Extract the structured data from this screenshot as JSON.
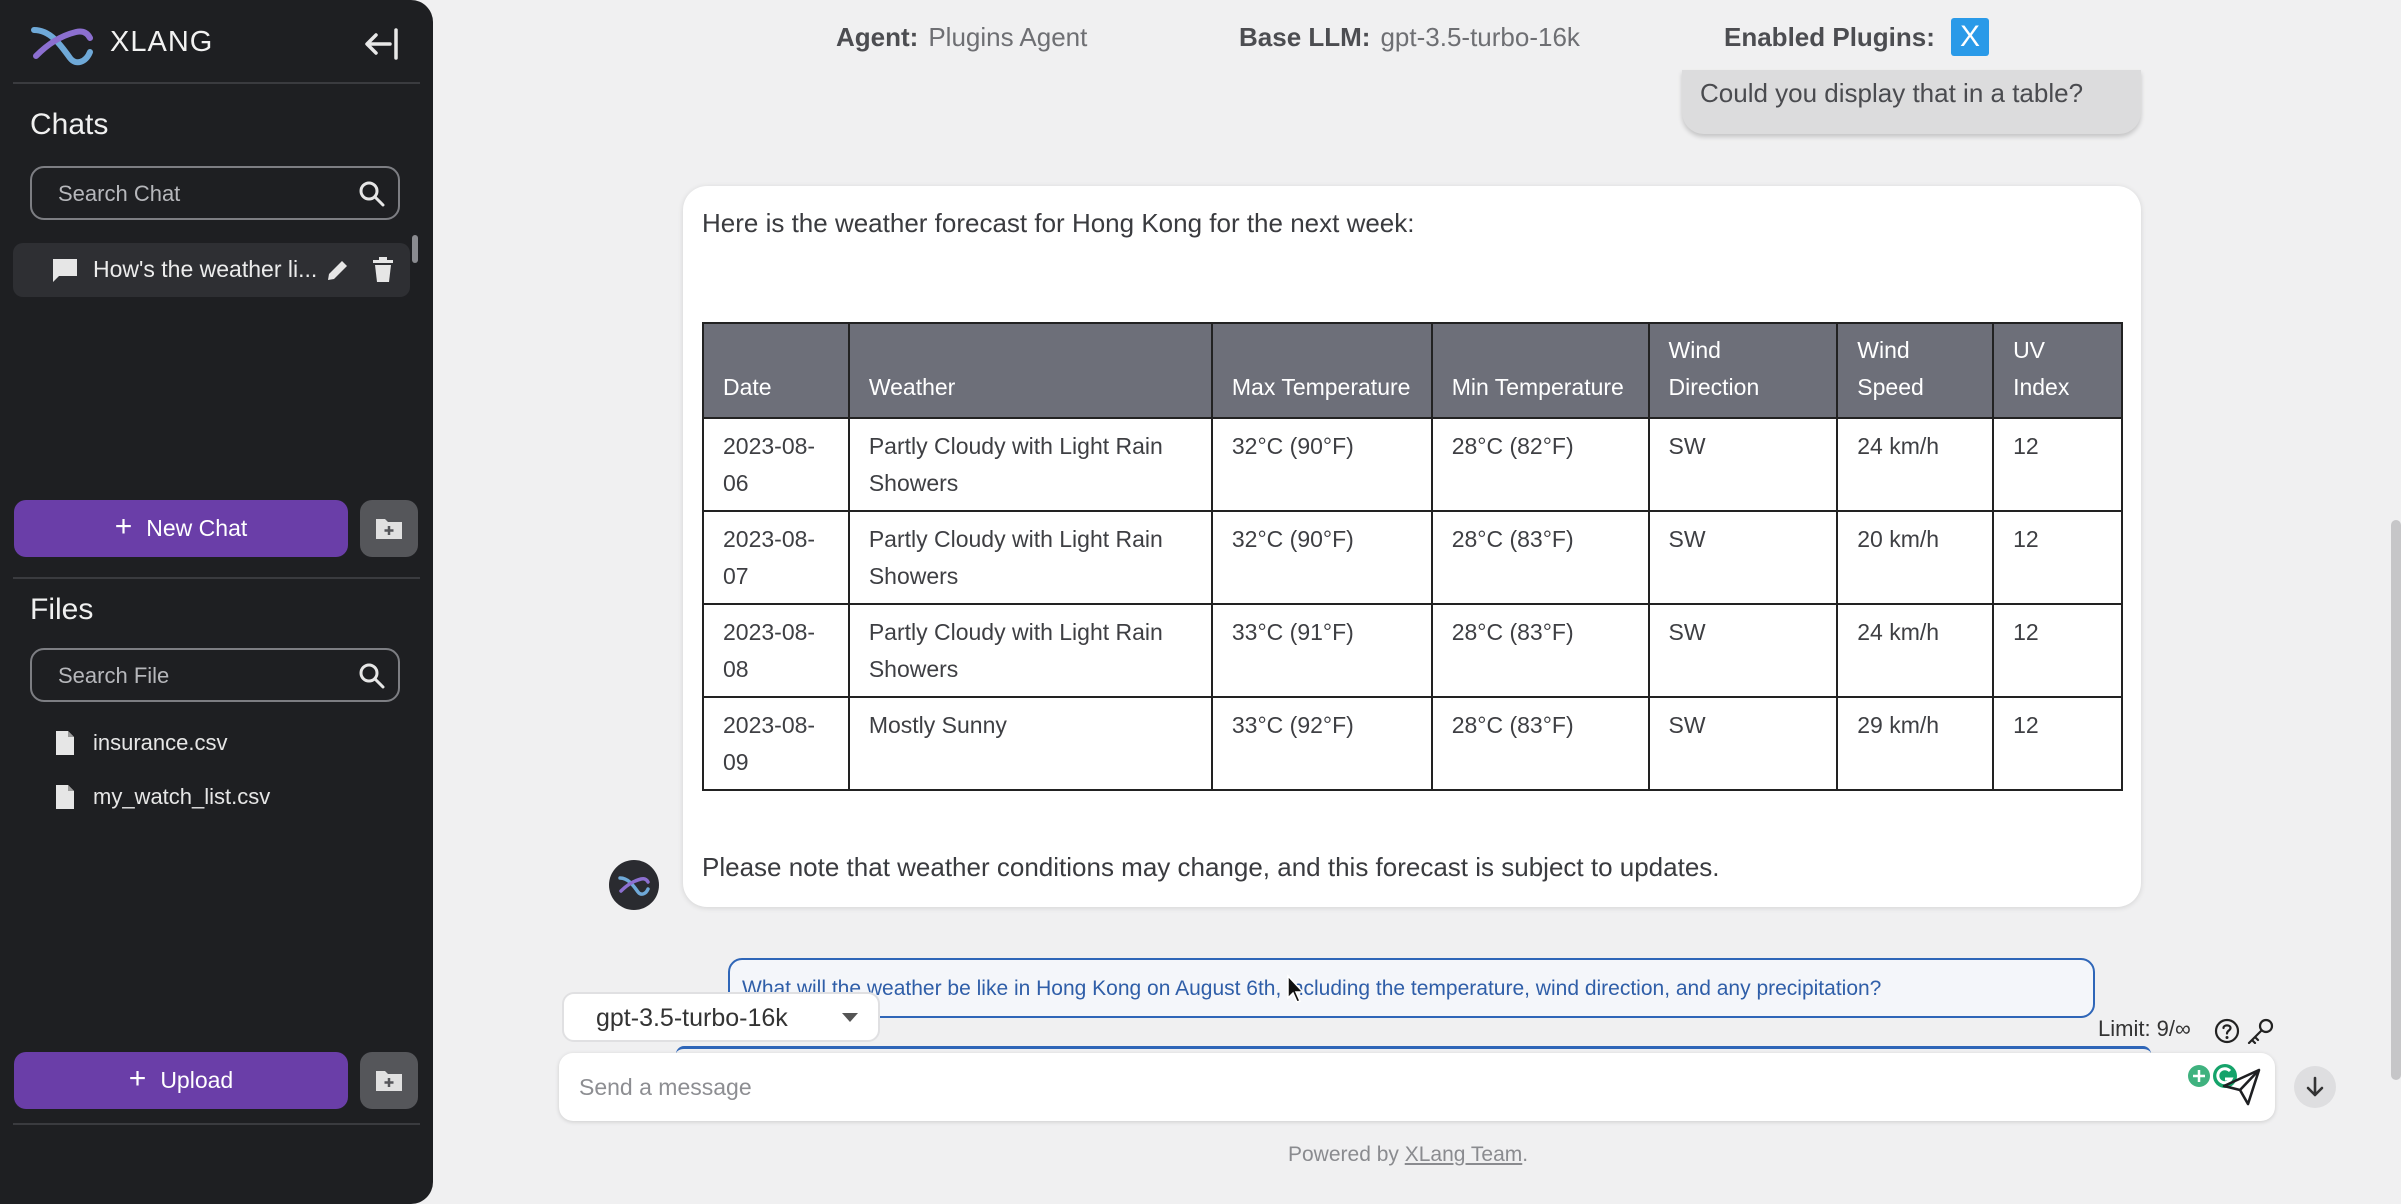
{
  "app": {
    "title": "XLANG"
  },
  "sidebar": {
    "chats_title": "Chats",
    "search_chat_placeholder": "Search Chat",
    "chats": [
      {
        "label": "How's the weather li..."
      }
    ],
    "new_chat_label": "New Chat",
    "files_title": "Files",
    "search_file_placeholder": "Search File",
    "files": [
      {
        "name": "insurance.csv"
      },
      {
        "name": "my_watch_list.csv"
      }
    ],
    "upload_label": "Upload"
  },
  "topbar": {
    "agent_label": "Agent:",
    "agent_value": "Plugins Agent",
    "llm_label": "Base LLM:",
    "llm_value": "gpt-3.5-turbo-16k",
    "plugins_label": "Enabled Plugins:",
    "plugin_badge": "X"
  },
  "conversation": {
    "user_message": "Could you display that in a table?",
    "bot_intro": "Here is the weather forecast for Hong Kong for the next week:",
    "bot_note": "Please note that weather conditions may change, and this forecast is subject to updates.",
    "table": {
      "headers": [
        "Date",
        "Weather",
        "Max Temperature",
        "Min Temperature",
        "Wind Direction",
        "Wind Speed",
        "UV Index"
      ],
      "rows": [
        [
          "2023-08-06",
          "Partly Cloudy with Light Rain Showers",
          "32°C (90°F)",
          "28°C (82°F)",
          "SW",
          "24 km/h",
          "12"
        ],
        [
          "2023-08-07",
          "Partly Cloudy with Light Rain Showers",
          "32°C (90°F)",
          "28°C (83°F)",
          "SW",
          "20 km/h",
          "12"
        ],
        [
          "2023-08-08",
          "Partly Cloudy with Light Rain Showers",
          "33°C (91°F)",
          "28°C (83°F)",
          "SW",
          "24 km/h",
          "12"
        ],
        [
          "2023-08-09",
          "Mostly Sunny",
          "33°C (92°F)",
          "28°C (83°F)",
          "SW",
          "29 km/h",
          "12"
        ]
      ]
    }
  },
  "composer": {
    "suggestion": "What will the weather be like in Hong Kong on August 6th, including the temperature, wind direction, and any precipitation?",
    "model_selected": "gpt-3.5-turbo-16k",
    "limit_text": "Limit: 9/∞",
    "input_placeholder": "Send a message"
  },
  "footer": {
    "prefix": "Powered by ",
    "link": "XLang Team",
    "suffix": "."
  },
  "colors": {
    "accent": "#6a3ea8",
    "sidebar_bg": "#1e1f22",
    "table_header": "#6d6f79",
    "link_blue": "#2f66b8"
  }
}
